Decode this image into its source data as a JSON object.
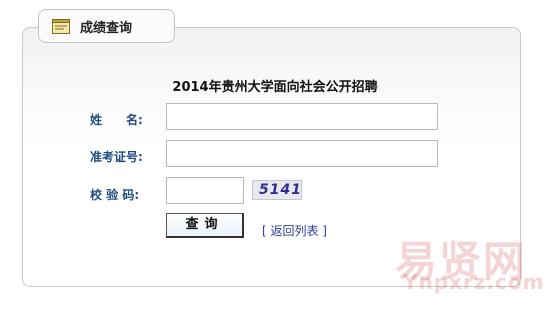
{
  "tab": {
    "title": "成绩查询",
    "icon": "notepad-icon"
  },
  "form": {
    "title": "2014年贵州大学面向社会公开招聘",
    "name_label": "姓　　名:",
    "name_value": "",
    "exam_id_label": "准考证号:",
    "exam_id_value": "",
    "captcha_label": "校 验 码:",
    "captcha_value": "",
    "captcha_text": "5141",
    "query_button": "查询",
    "back_link": "[ 返回列表 ]"
  },
  "watermark": {
    "main": "易贤网",
    "sub": "Ynpxrz.com"
  }
}
